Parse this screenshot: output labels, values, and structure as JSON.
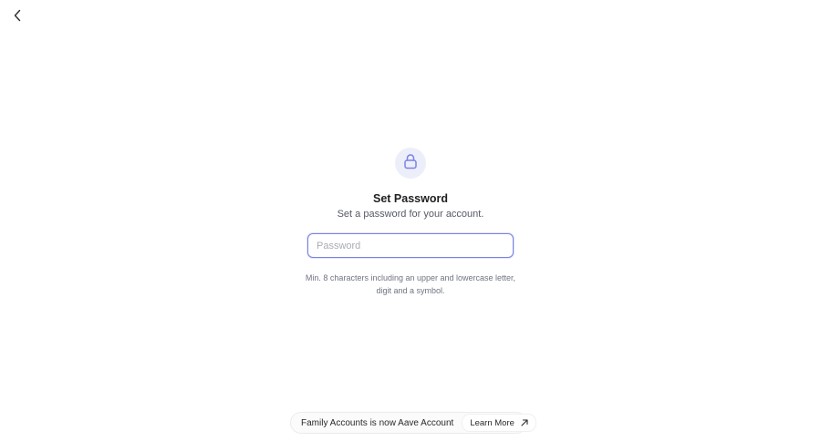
{
  "header": {
    "back_icon": "chevron-left-icon"
  },
  "main": {
    "icon": "lock-icon",
    "title": "Set Password",
    "subtitle": "Set a password for your account.",
    "password_placeholder": "Password",
    "password_value": "",
    "hint": "Min. 8 characters including an upper and lowercase letter, digit and a symbol."
  },
  "banner": {
    "text": "Family Accounts is now Aave Account",
    "link_label": "Learn More",
    "link_icon": "external-arrow-icon"
  },
  "colors": {
    "accent": "#7b83e0",
    "icon_bg": "#eceefa"
  }
}
